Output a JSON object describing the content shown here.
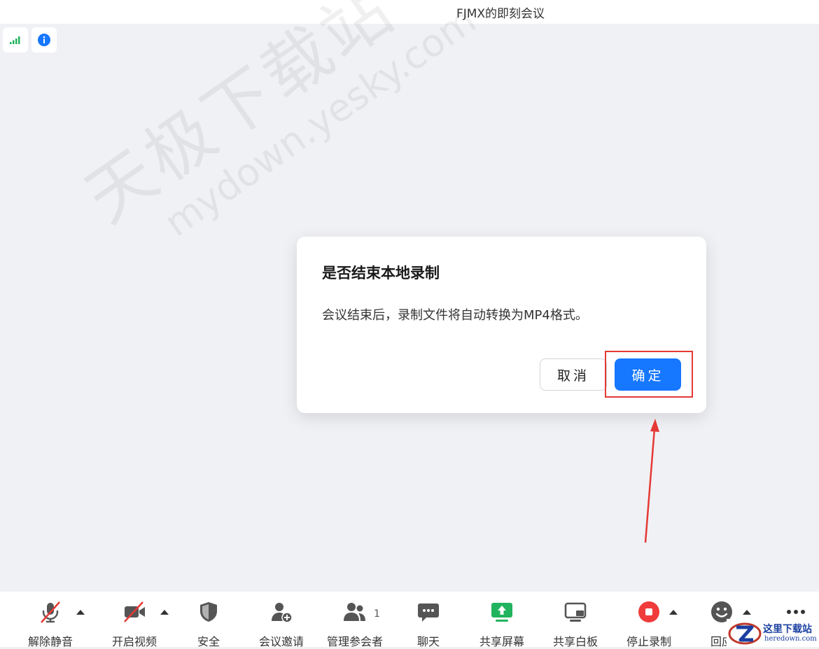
{
  "window": {
    "title": "FJMX的即刻会议"
  },
  "status": {
    "signal_icon": "signal-bars-icon",
    "info_icon": "info-icon"
  },
  "watermark": {
    "line1": "天极下载站",
    "line2": "mydown.yesky.com"
  },
  "dialog": {
    "title": "是否结束本地录制",
    "message": "会议结束后，录制文件将自动转换为MP4格式。",
    "cancel_label": "取消",
    "confirm_label": "确定"
  },
  "toolbar": {
    "items": [
      {
        "label": "解除静音",
        "icon": "mic-muted-icon"
      },
      {
        "label": "开启视频",
        "icon": "video-off-icon"
      },
      {
        "label": "安全",
        "icon": "shield-icon"
      },
      {
        "label": "会议邀请",
        "icon": "add-user-icon"
      },
      {
        "label": "管理参会者",
        "icon": "participants-icon",
        "count": "1"
      },
      {
        "label": "聊天",
        "icon": "chat-icon"
      },
      {
        "label": "共享屏幕",
        "icon": "share-screen-icon"
      },
      {
        "label": "共享白板",
        "icon": "whiteboard-icon"
      },
      {
        "label": "停止录制",
        "icon": "stop-record-icon"
      },
      {
        "label": "回应",
        "icon": "emoji-icon"
      }
    ],
    "more_icon": "more-icon"
  },
  "colors": {
    "accent": "#1677ff",
    "highlight": "#e53935",
    "record": "#f03b3b",
    "share": "#22b35e"
  },
  "corner_logo": {
    "cn": "这里下载站",
    "en": "heredown.com"
  }
}
